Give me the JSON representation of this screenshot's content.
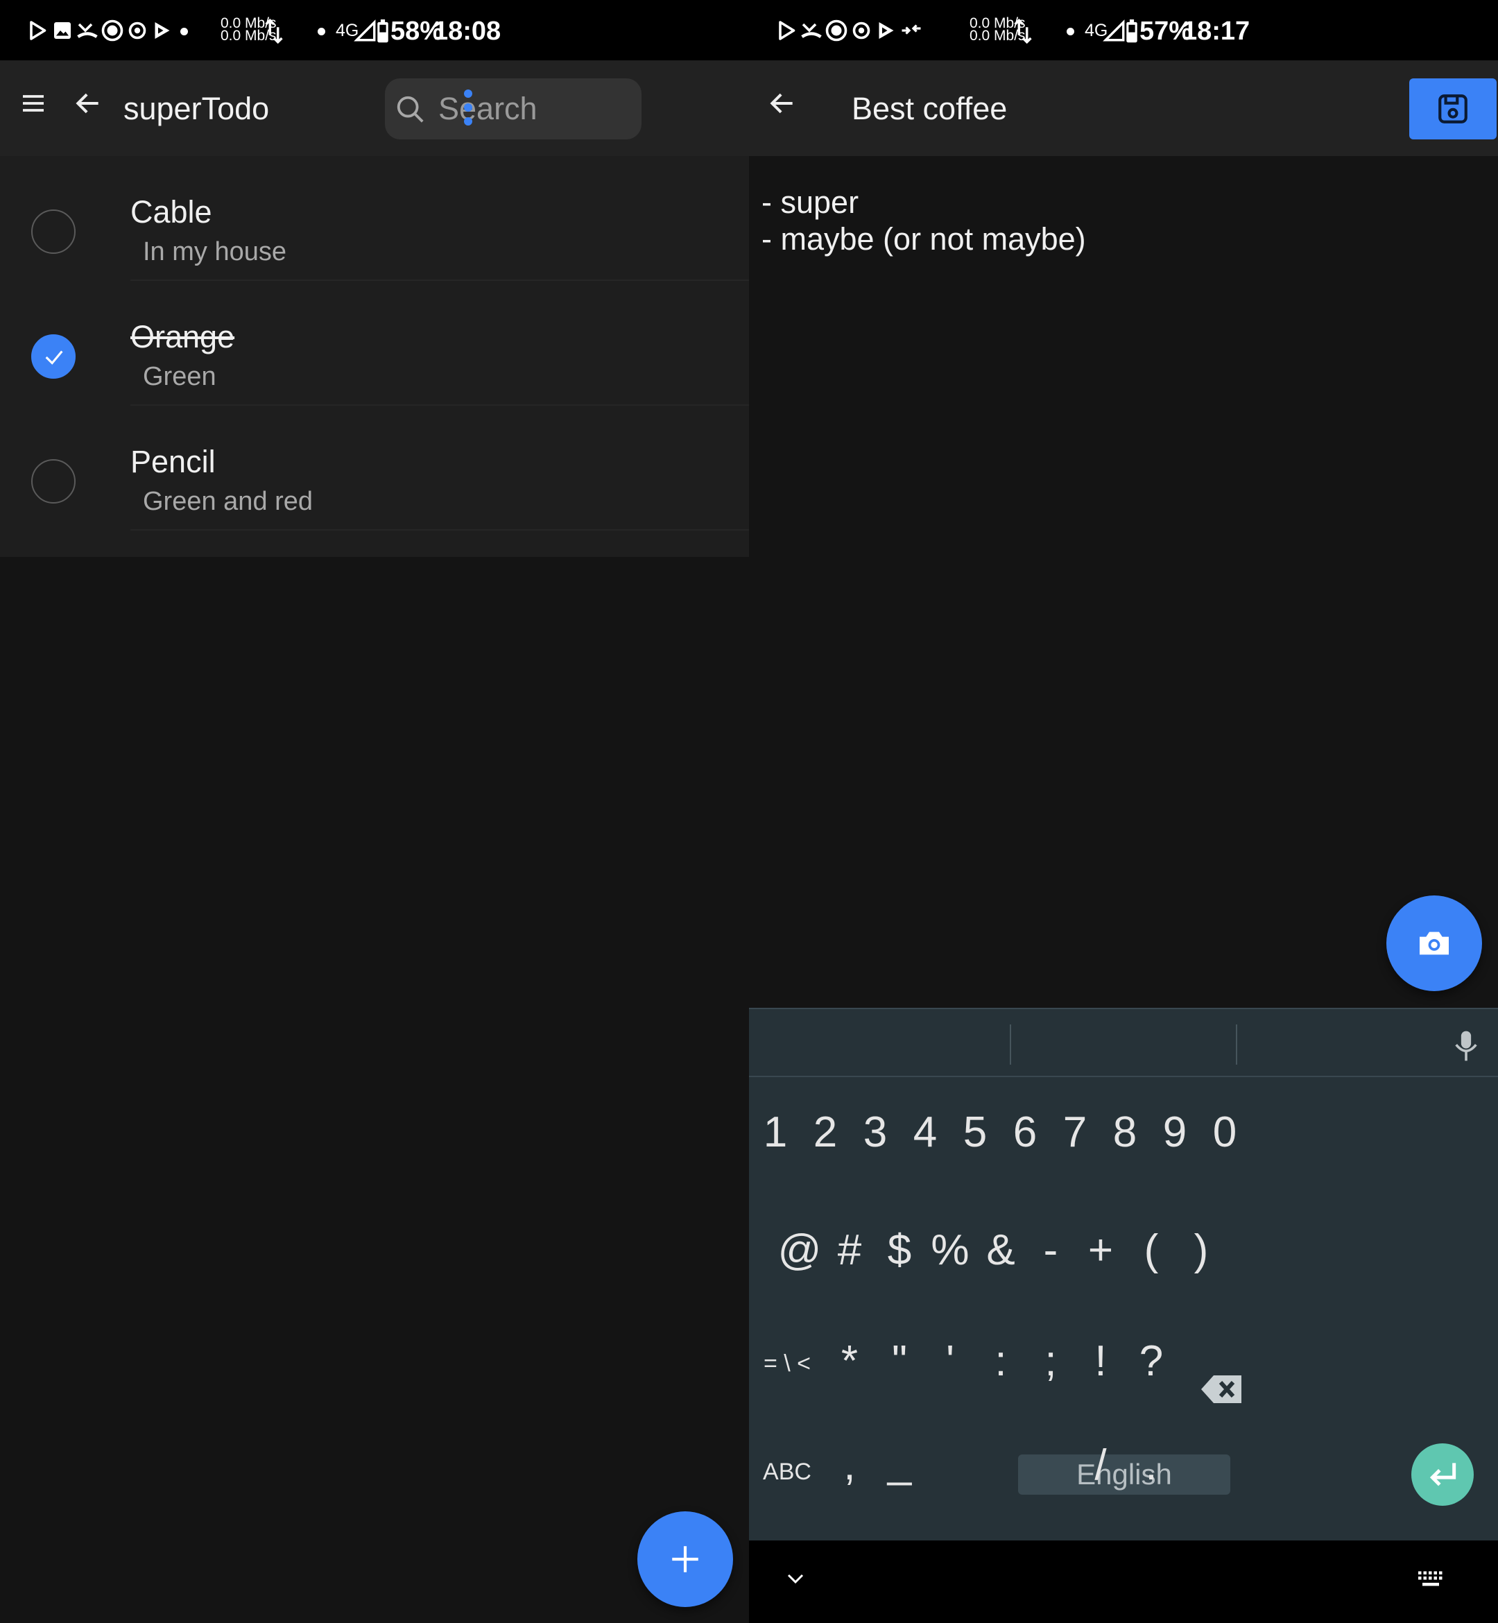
{
  "left": {
    "status": {
      "speed_up": "0.0 Mb/s",
      "speed_down": "0.0 Mb/s",
      "network": "4G",
      "battery_pct": "58%",
      "time": "18:08"
    },
    "app_bar": {
      "menu_icon": "hamburger-menu-icon",
      "back_icon": "arrow-left-icon",
      "title": "superTodo",
      "search_placeholder": "Search",
      "overflow_icon": "more-vertical-icon"
    },
    "todos": [
      {
        "title": "Cable",
        "subtitle": "In my house",
        "done": false
      },
      {
        "title": "Orange",
        "subtitle": "Green",
        "done": true
      },
      {
        "title": "Pencil",
        "subtitle": "Green and red",
        "done": false
      }
    ],
    "fab_icon": "plus-icon"
  },
  "right": {
    "status": {
      "speed_up": "0.0 Mb/s",
      "speed_down": "0.0 Mb/s",
      "network": "4G",
      "battery_pct": "57%",
      "time": "18:17"
    },
    "app_bar": {
      "back_icon": "arrow-left-icon",
      "title": "Best coffee",
      "save_icon": "save-icon"
    },
    "note_lines": [
      "- super",
      "- maybe (or not maybe)"
    ],
    "camera_icon": "camera-icon",
    "keyboard": {
      "row_numbers": [
        "1",
        "2",
        "3",
        "4",
        "5",
        "6",
        "7",
        "8",
        "9",
        "0"
      ],
      "row_symbols_1": [
        "@",
        "#",
        "$",
        "%",
        "&",
        "-",
        "+",
        "(",
        ")"
      ],
      "row_symbols_2": [
        "= \\ <",
        "*",
        "\"",
        "'",
        ":",
        ";",
        "!",
        "?"
      ],
      "row_bottom": {
        "abc": "ABC",
        "comma": ",",
        "underscore": "_",
        "space": "English",
        "slash": "/",
        "period": "."
      },
      "accent_color": "#5fc7b0"
    },
    "colors": {
      "accent": "#3b82f6",
      "background": "#141414",
      "app_bar": "#222222"
    }
  }
}
